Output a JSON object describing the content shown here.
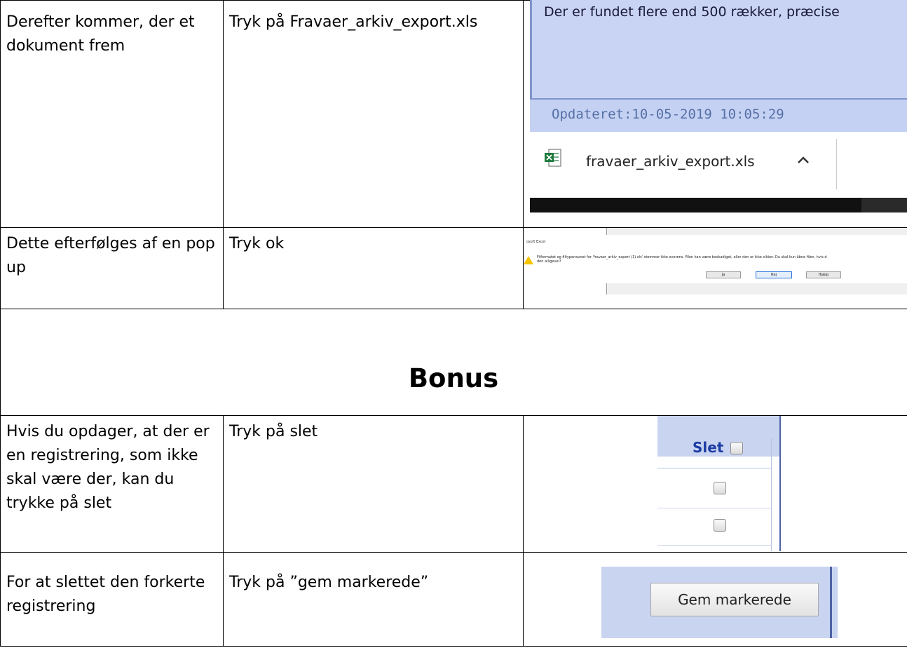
{
  "rows": [
    {
      "description": "Derefter kommer, der et dokument frem",
      "action": "Tryk på Fravaer_arkiv_export.xls",
      "screenshot": {
        "panel_text": "Der er fundet flere end 500 rækker, præcise",
        "updated_text": "Opdateret:10-05-2019 10:05:29",
        "file_name": "fravaer_arkiv_export.xls",
        "file_icon": "excel-file-icon",
        "chevron_icon": "chevron-up-icon"
      }
    },
    {
      "description": "Dette efterfølges af en pop up",
      "action": "Tryk ok",
      "screenshot": {
        "title": "osoft Excel",
        "message_line1": "Filformatet og filtypenavnet for 'fravaer_arkiv_export (1).xls' stemmer ikke overens. Filen kan være beskadiget, eller den er ikke sikker. Du skal kun åbne filen, hvis d",
        "message_line2": "den alligevel?",
        "button_yes": "Ja",
        "button_no": "Nej",
        "button_help": "Hjælp",
        "warning_icon": "warning-icon"
      }
    }
  ],
  "bonus_heading": "Bonus",
  "bonus_rows": [
    {
      "description": "Hvis du opdager, at der er en registrering, som ikke skal være der, kan du trykke på slet",
      "action": "Tryk på slet",
      "screenshot": {
        "column_label": "Slet"
      }
    },
    {
      "description": "For at slettet den forkerte registrering",
      "action": "Tryk på ”gem markerede”",
      "screenshot": {
        "button_label": "Gem markerede"
      }
    }
  ]
}
